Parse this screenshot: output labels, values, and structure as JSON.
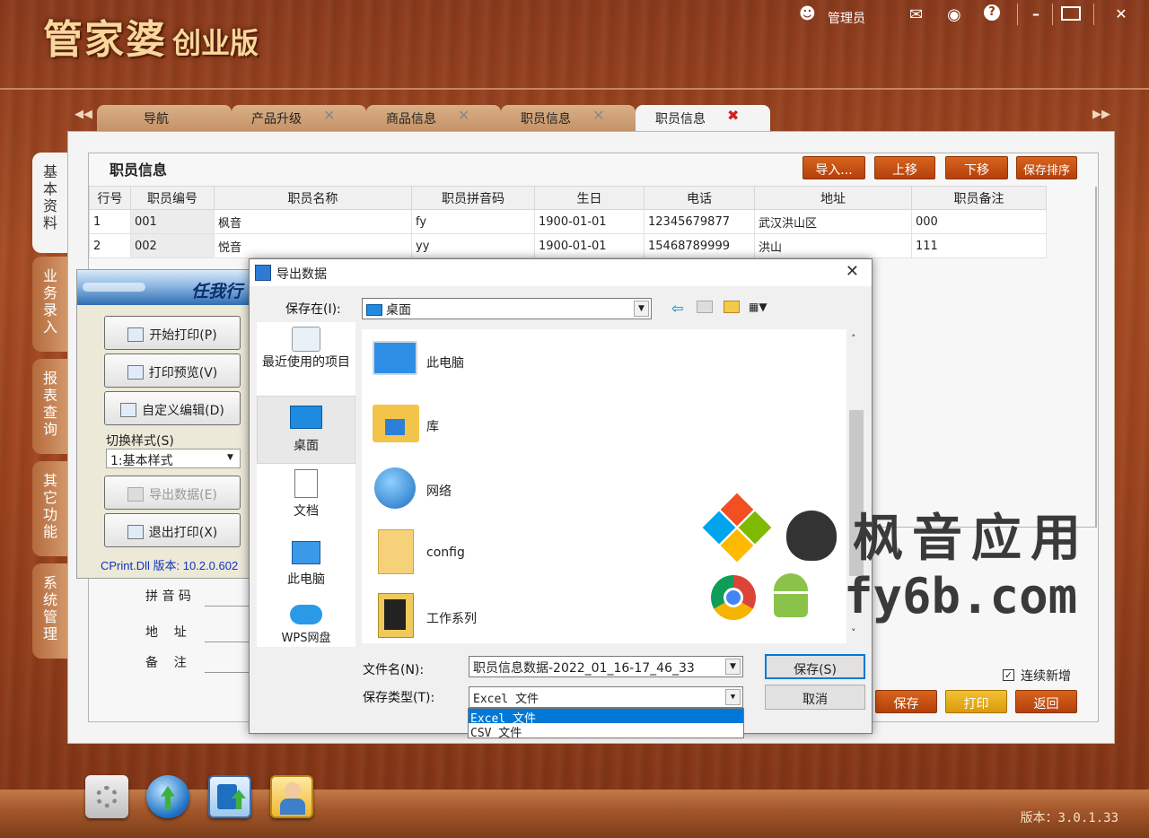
{
  "app": {
    "title_main": "管家婆",
    "title_sub": "创业版",
    "user": "管理员",
    "version": "版本：3.0.1.33"
  },
  "tabs": [
    {
      "label": "导航"
    },
    {
      "label": "产品升级"
    },
    {
      "label": "商品信息"
    },
    {
      "label": "职员信息"
    },
    {
      "label": "职员信息"
    }
  ],
  "side_tabs": [
    "基本资料",
    "业务录入",
    "报表查询",
    "其它功能",
    "系统管理"
  ],
  "section": {
    "title": "职员信息",
    "buttons": {
      "import": "导入...",
      "up": "上移",
      "down": "下移",
      "save_order": "保存排序"
    }
  },
  "grid": {
    "headers": [
      "行号",
      "职员编号",
      "职员名称",
      "职员拼音码",
      "生日",
      "电话",
      "地址",
      "职员备注"
    ],
    "rows": [
      [
        "1",
        "001",
        "枫音",
        "fy",
        "1900-01-01",
        "12345679877",
        "武汉洪山区",
        "000"
      ],
      [
        "2",
        "002",
        "悦音",
        "yy",
        "1900-01-01",
        "15468789999",
        "洪山",
        "111"
      ]
    ]
  },
  "form": {
    "pinyin_label": "拼 音 码",
    "address_label": "地    址",
    "note_label": "备    注",
    "continuous_add": "连续新增",
    "save": "保存",
    "print": "打印",
    "back": "返回"
  },
  "print_panel": {
    "logo": "任我行",
    "start_print": "开始打印(P)",
    "preview": "打印预览(V)",
    "custom_edit": "自定义编辑(D)",
    "switch_style_label": "切换样式(S)",
    "style_value": "1:基本样式",
    "export": "导出数据(E)",
    "exit": "退出打印(X)",
    "version": "CPrint.Dll 版本: 10.2.0.602"
  },
  "dialog": {
    "title": "导出数据",
    "save_in_label": "保存在(I):",
    "save_in_value": "桌面",
    "places": [
      "最近使用的项目",
      "桌面",
      "文档",
      "此电脑",
      "WPS网盘"
    ],
    "files": [
      "此电脑",
      "库",
      "网络",
      "config",
      "工作系列"
    ],
    "filename_label": "文件名(N):",
    "filename_value": "职员信息数据-2022_01_16-17_46_33",
    "filetype_label": "保存类型(T):",
    "filetype_value": "Excel 文件",
    "filetype_options": [
      "Excel 文件",
      "CSV 文件"
    ],
    "save_button": "保存(S)",
    "cancel_button": "取消"
  },
  "watermark": {
    "line1": "枫音应用",
    "line2": "fy6b.com"
  }
}
